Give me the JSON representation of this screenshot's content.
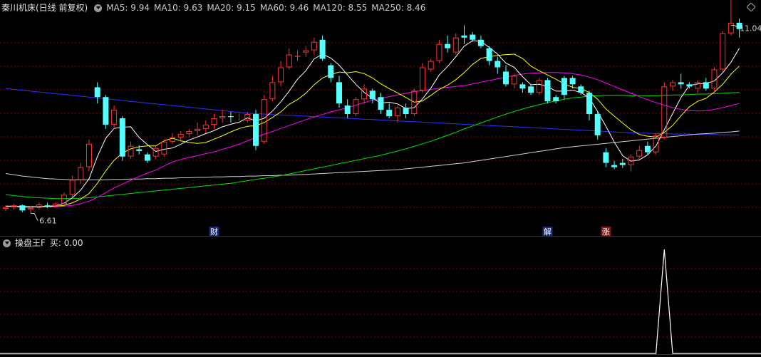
{
  "header": {
    "title": "秦川机床(日线 前复权)",
    "ma": [
      {
        "label": "MA5: 9.94",
        "color": "#ffffff"
      },
      {
        "label": "MA10: 9.63",
        "color": "#ffff00"
      },
      {
        "label": "MA20: 9.15",
        "color": "#ff00ff"
      },
      {
        "label": "MA60: 9.46",
        "color": "#00e000"
      },
      {
        "label": "MA120: 8.55",
        "color": "#d0d0d0"
      },
      {
        "label": "MA250: 8.46",
        "color": "#3030ff"
      }
    ]
  },
  "sub_header": {
    "title": "操盘王F",
    "value": "买: 0.00"
  },
  "annotations": {
    "high_label": "11.04",
    "low_label": "6.61",
    "events": [
      {
        "text": "财",
        "bar": 25,
        "bg": "#1a2a6e",
        "color": "#ffffff"
      },
      {
        "text": "解",
        "bar": 65,
        "bg": "#1a2a6e",
        "color": "#ffffff"
      },
      {
        "text": "涨",
        "bar": 72,
        "bg": "#7a1a1a",
        "color": "#ffffff"
      }
    ]
  },
  "colors": {
    "up": "#ff3232",
    "down": "#54ffff",
    "grid": "#8a0000",
    "separator": "#b00000"
  },
  "chart_data": {
    "type": "candlestick",
    "ylim": [
      6.3,
      11.3
    ],
    "high": 11.04,
    "low": 6.61,
    "ohlc": [
      [
        6.72,
        6.8,
        6.66,
        6.76
      ],
      [
        6.76,
        6.84,
        6.7,
        6.8
      ],
      [
        6.8,
        6.82,
        6.64,
        6.68
      ],
      [
        6.7,
        6.78,
        6.61,
        6.74
      ],
      [
        6.74,
        6.86,
        6.7,
        6.82
      ],
      [
        6.8,
        6.86,
        6.74,
        6.78
      ],
      [
        6.78,
        6.88,
        6.74,
        6.84
      ],
      [
        6.84,
        7.1,
        6.8,
        7.05
      ],
      [
        7.05,
        7.5,
        7.0,
        7.4
      ],
      [
        7.4,
        7.8,
        7.3,
        7.7
      ],
      [
        7.7,
        8.35,
        7.6,
        8.25
      ],
      [
        9.58,
        9.7,
        9.2,
        9.35
      ],
      [
        9.35,
        9.4,
        8.6,
        8.7
      ],
      [
        8.7,
        9.15,
        8.6,
        9.05
      ],
      [
        8.85,
        8.9,
        7.85,
        7.95
      ],
      [
        7.95,
        8.3,
        7.9,
        8.2
      ],
      [
        8.12,
        8.22,
        8.0,
        8.08
      ],
      [
        8.0,
        8.05,
        7.8,
        7.85
      ],
      [
        7.95,
        8.2,
        7.9,
        8.15
      ],
      [
        8.0,
        8.35,
        7.95,
        8.3
      ],
      [
        8.3,
        8.5,
        8.25,
        8.4
      ],
      [
        8.4,
        8.55,
        8.3,
        8.48
      ],
      [
        8.48,
        8.6,
        8.4,
        8.55
      ],
      [
        8.55,
        8.75,
        8.45,
        8.6
      ],
      [
        8.6,
        8.8,
        8.5,
        8.7
      ],
      [
        8.7,
        8.95,
        8.6,
        8.85
      ],
      [
        8.85,
        9.05,
        8.75,
        8.9
      ],
      [
        8.9,
        9.0,
        8.75,
        8.88
      ],
      [
        8.88,
        8.95,
        8.8,
        8.88
      ],
      [
        8.8,
        9.0,
        8.75,
        8.95
      ],
      [
        8.95,
        9.05,
        8.1,
        8.2
      ],
      [
        8.3,
        9.4,
        8.25,
        9.3
      ],
      [
        9.3,
        9.85,
        9.25,
        9.7
      ],
      [
        9.7,
        10.2,
        9.6,
        10.05
      ],
      [
        10.05,
        10.5,
        10.0,
        10.35
      ],
      [
        10.3,
        10.45,
        10.2,
        10.32
      ],
      [
        10.4,
        10.55,
        10.3,
        10.45
      ],
      [
        10.45,
        10.75,
        10.35,
        10.65
      ],
      [
        10.7,
        10.8,
        10.2,
        10.25
      ],
      [
        10.1,
        10.15,
        9.7,
        9.8
      ],
      [
        9.7,
        9.85,
        9.1,
        9.2
      ],
      [
        9.15,
        9.3,
        8.85,
        8.95
      ],
      [
        8.95,
        9.35,
        8.9,
        9.3
      ],
      [
        9.3,
        9.65,
        9.2,
        9.55
      ],
      [
        9.5,
        9.55,
        9.2,
        9.3
      ],
      [
        9.35,
        9.45,
        8.95,
        9.05
      ],
      [
        9.05,
        9.2,
        8.85,
        8.9
      ],
      [
        8.9,
        9.15,
        8.75,
        9.1
      ],
      [
        9.1,
        9.2,
        8.85,
        8.95
      ],
      [
        8.95,
        9.55,
        8.9,
        9.5
      ],
      [
        9.5,
        10.15,
        9.45,
        10.05
      ],
      [
        10.0,
        10.25,
        9.95,
        10.2
      ],
      [
        10.2,
        10.7,
        10.15,
        10.6
      ],
      [
        10.6,
        10.8,
        10.4,
        10.5
      ],
      [
        10.4,
        10.85,
        10.35,
        10.75
      ],
      [
        10.8,
        11.04,
        10.6,
        10.75
      ],
      [
        10.82,
        10.88,
        10.65,
        10.7
      ],
      [
        10.7,
        10.8,
        10.5,
        10.55
      ],
      [
        10.5,
        10.55,
        10.1,
        10.2
      ],
      [
        10.2,
        10.3,
        9.9,
        10.05
      ],
      [
        9.95,
        10.1,
        9.6,
        9.65
      ],
      [
        9.65,
        9.9,
        9.55,
        9.85
      ],
      [
        9.65,
        9.7,
        9.45,
        9.55
      ],
      [
        9.6,
        9.65,
        9.4,
        9.45
      ],
      [
        9.45,
        9.8,
        9.4,
        9.75
      ],
      [
        9.75,
        9.8,
        9.2,
        9.25
      ],
      [
        9.35,
        9.4,
        9.2,
        9.25
      ],
      [
        9.8,
        9.85,
        9.3,
        9.4
      ],
      [
        9.8,
        9.85,
        9.55,
        9.65
      ],
      [
        9.6,
        9.65,
        9.4,
        9.45
      ],
      [
        9.45,
        9.5,
        8.8,
        8.95
      ],
      [
        8.95,
        9.0,
        8.35,
        8.45
      ],
      [
        8.05,
        8.15,
        7.7,
        7.8
      ],
      [
        7.75,
        7.85,
        7.65,
        7.7
      ],
      [
        7.8,
        7.9,
        7.68,
        7.75
      ],
      [
        7.75,
        8.0,
        7.6,
        7.95
      ],
      [
        7.95,
        8.2,
        7.85,
        8.1
      ],
      [
        8.2,
        8.3,
        8.0,
        8.05
      ],
      [
        8.05,
        8.5,
        8.0,
        8.45
      ],
      [
        8.4,
        9.7,
        8.35,
        9.6
      ],
      [
        9.6,
        9.75,
        9.5,
        9.7
      ],
      [
        9.7,
        9.9,
        9.55,
        9.65
      ],
      [
        9.65,
        9.7,
        9.55,
        9.6
      ],
      [
        9.55,
        9.75,
        9.45,
        9.7
      ],
      [
        9.7,
        9.8,
        9.5,
        9.55
      ],
      [
        9.55,
        10.05,
        9.5,
        10.0
      ],
      [
        10.0,
        10.9,
        9.95,
        10.85
      ],
      [
        10.85,
        11.7,
        10.8,
        11.1
      ],
      [
        11.1,
        11.2,
        10.75,
        10.95
      ]
    ],
    "ma": {
      "MA5": [
        6.78,
        6.78,
        6.76,
        6.76,
        6.77,
        6.78,
        6.79,
        6.85,
        6.98,
        7.16,
        7.43,
        7.95,
        8.38,
        8.61,
        8.64,
        8.65,
        8.4,
        8.23,
        8.07,
        8.12,
        8.15,
        8.24,
        8.34,
        8.41,
        8.49,
        8.56,
        8.65,
        8.71,
        8.76,
        8.86,
        8.79,
        8.85,
        9.02,
        9.24,
        9.49,
        9.77,
        9.97,
        10.25,
        10.36,
        10.27,
        10.1,
        9.87,
        9.65,
        9.46,
        9.32,
        9.21,
        9.23,
        9.19,
        9.08,
        9.1,
        9.31,
        9.56,
        9.87,
        10.07,
        10.3,
        10.55,
        10.68,
        10.66,
        10.52,
        10.36,
        10.15,
        10.05,
        9.83,
        9.64,
        9.65,
        9.6,
        9.49,
        9.49,
        9.51,
        9.46,
        9.33,
        9.01,
        8.66,
        8.29,
        7.97,
        7.84,
        7.87,
        7.99,
        8.2,
        8.58,
        8.96,
        9.34,
        9.62,
        9.66,
        9.67,
        9.73,
        9.92,
        10.17,
        10.5
      ],
      "MA10": [
        6.78,
        6.78,
        6.77,
        6.77,
        6.77,
        6.77,
        6.78,
        6.8,
        6.86,
        6.95,
        7.08,
        7.32,
        7.61,
        7.86,
        8.03,
        8.13,
        8.18,
        8.2,
        8.2,
        8.32,
        8.38,
        8.32,
        8.28,
        8.26,
        8.28,
        8.36,
        8.44,
        8.53,
        8.61,
        8.66,
        8.68,
        8.75,
        8.87,
        9.0,
        9.18,
        9.29,
        9.44,
        9.64,
        9.8,
        9.88,
        9.94,
        9.92,
        9.95,
        9.9,
        9.8,
        9.66,
        9.55,
        9.45,
        9.34,
        9.23,
        9.26,
        9.39,
        9.53,
        9.63,
        9.76,
        9.93,
        10.12,
        10.26,
        10.3,
        10.33,
        10.35,
        10.36,
        10.26,
        10.08,
        9.97,
        9.87,
        9.77,
        9.66,
        9.58,
        9.55,
        9.46,
        9.3,
        9.07,
        8.9,
        8.74,
        8.58,
        8.47,
        8.43,
        8.41,
        8.52,
        8.68,
        8.91,
        9.12,
        9.25,
        9.32,
        9.47,
        9.65,
        9.89,
        10.08
      ],
      "MA20": [
        6.78,
        6.78,
        6.78,
        6.77,
        6.77,
        6.77,
        6.77,
        6.78,
        6.8,
        6.84,
        6.9,
        6.99,
        7.1,
        7.21,
        7.3,
        7.39,
        7.48,
        7.56,
        7.63,
        7.73,
        7.82,
        7.88,
        7.93,
        7.97,
        8.02,
        8.06,
        8.12,
        8.18,
        8.24,
        8.32,
        8.4,
        8.48,
        8.54,
        8.61,
        8.68,
        8.75,
        8.82,
        8.88,
        8.94,
        9.0,
        9.05,
        9.1,
        9.16,
        9.22,
        9.28,
        9.32,
        9.36,
        9.4,
        9.44,
        9.48,
        9.5,
        9.53,
        9.56,
        9.58,
        9.6,
        9.62,
        9.66,
        9.7,
        9.74,
        9.78,
        9.82,
        9.86,
        9.89,
        9.91,
        9.92,
        9.93,
        9.93,
        9.92,
        9.9,
        9.87,
        9.82,
        9.76,
        9.68,
        9.6,
        9.52,
        9.44,
        9.36,
        9.29,
        9.22,
        9.16,
        9.1,
        9.06,
        9.03,
        9.02,
        9.03,
        9.06,
        9.1,
        9.15,
        9.2
      ],
      "MA60": [
        7.05,
        7.03,
        7.01,
        6.99,
        6.98,
        6.97,
        6.96,
        6.96,
        6.96,
        6.97,
        6.98,
        7.0,
        7.02,
        7.04,
        7.06,
        7.08,
        7.1,
        7.12,
        7.14,
        7.16,
        7.18,
        7.2,
        7.22,
        7.24,
        7.26,
        7.28,
        7.3,
        7.32,
        7.35,
        7.38,
        7.41,
        7.44,
        7.47,
        7.5,
        7.54,
        7.58,
        7.62,
        7.66,
        7.7,
        7.74,
        7.78,
        7.82,
        7.86,
        7.9,
        7.94,
        7.98,
        8.03,
        8.08,
        8.13,
        8.19,
        8.25,
        8.31,
        8.38,
        8.45,
        8.52,
        8.6,
        8.67,
        8.74,
        8.81,
        8.88,
        8.95,
        9.01,
        9.07,
        9.12,
        9.17,
        9.22,
        9.26,
        9.3,
        9.33,
        9.35,
        9.37,
        9.38,
        9.39,
        9.39,
        9.39,
        9.38,
        9.38,
        9.38,
        9.38,
        9.39,
        9.4,
        9.4,
        9.41,
        9.42,
        9.42,
        9.43,
        9.44,
        9.45,
        9.46
      ],
      "MA120": [
        7.55,
        7.52,
        7.49,
        7.47,
        7.45,
        7.43,
        7.42,
        7.41,
        7.4,
        7.4,
        7.4,
        7.4,
        7.4,
        7.41,
        7.41,
        7.42,
        7.42,
        7.43,
        7.43,
        7.44,
        7.44,
        7.45,
        7.45,
        7.46,
        7.46,
        7.47,
        7.47,
        7.48,
        7.48,
        7.49,
        7.49,
        7.5,
        7.5,
        7.51,
        7.51,
        7.52,
        7.53,
        7.54,
        7.55,
        7.56,
        7.57,
        7.58,
        7.59,
        7.6,
        7.61,
        7.62,
        7.63,
        7.64,
        7.66,
        7.68,
        7.7,
        7.72,
        7.74,
        7.76,
        7.78,
        7.8,
        7.83,
        7.86,
        7.89,
        7.92,
        7.95,
        7.98,
        8.01,
        8.04,
        8.07,
        8.1,
        8.13,
        8.16,
        8.18,
        8.2,
        8.22,
        8.24,
        8.26,
        8.28,
        8.3,
        8.32,
        8.34,
        8.36,
        8.38,
        8.4,
        8.42,
        8.44,
        8.46,
        8.48,
        8.49,
        8.5,
        8.52,
        8.53,
        8.55
      ],
      "MA250": [
        9.55,
        9.53,
        9.51,
        9.49,
        9.47,
        9.45,
        9.43,
        9.41,
        9.39,
        9.37,
        9.35,
        9.33,
        9.31,
        9.29,
        9.27,
        9.25,
        9.23,
        9.21,
        9.19,
        9.17,
        9.15,
        9.13,
        9.11,
        9.09,
        9.07,
        9.05,
        9.03,
        9.01,
        8.99,
        8.97,
        8.96,
        8.95,
        8.94,
        8.93,
        8.92,
        8.91,
        8.9,
        8.89,
        8.88,
        8.87,
        8.86,
        8.85,
        8.84,
        8.83,
        8.82,
        8.81,
        8.8,
        8.79,
        8.78,
        8.77,
        8.76,
        8.75,
        8.74,
        8.73,
        8.72,
        8.71,
        8.7,
        8.69,
        8.68,
        8.67,
        8.66,
        8.65,
        8.64,
        8.63,
        8.62,
        8.61,
        8.6,
        8.59,
        8.58,
        8.57,
        8.56,
        8.55,
        8.54,
        8.53,
        8.52,
        8.51,
        8.5,
        8.5,
        8.49,
        8.49,
        8.48,
        8.48,
        8.48,
        8.47,
        8.47,
        8.47,
        8.46,
        8.46,
        8.46
      ]
    },
    "indicator": {
      "name": "操盘王F",
      "values": [
        0,
        0,
        0,
        0,
        0,
        0,
        0,
        0,
        0,
        0,
        0,
        0,
        0,
        0,
        0,
        0,
        0,
        0,
        0,
        0,
        0,
        0,
        0,
        0,
        0,
        0,
        0,
        0,
        0,
        0,
        0,
        0,
        0,
        0,
        0,
        0,
        0,
        0,
        0,
        0,
        0,
        0,
        0,
        0,
        0,
        0,
        0,
        0,
        0,
        0,
        0,
        0,
        0,
        0,
        0,
        0,
        0,
        0,
        0,
        0,
        0,
        0,
        0,
        0,
        0,
        0,
        0,
        0,
        0,
        0,
        0,
        0,
        0,
        0,
        0,
        0,
        0,
        0,
        0,
        1,
        0,
        0,
        0,
        0,
        0,
        0,
        0,
        0,
        0
      ],
      "ylim": [
        0,
        1
      ]
    }
  }
}
